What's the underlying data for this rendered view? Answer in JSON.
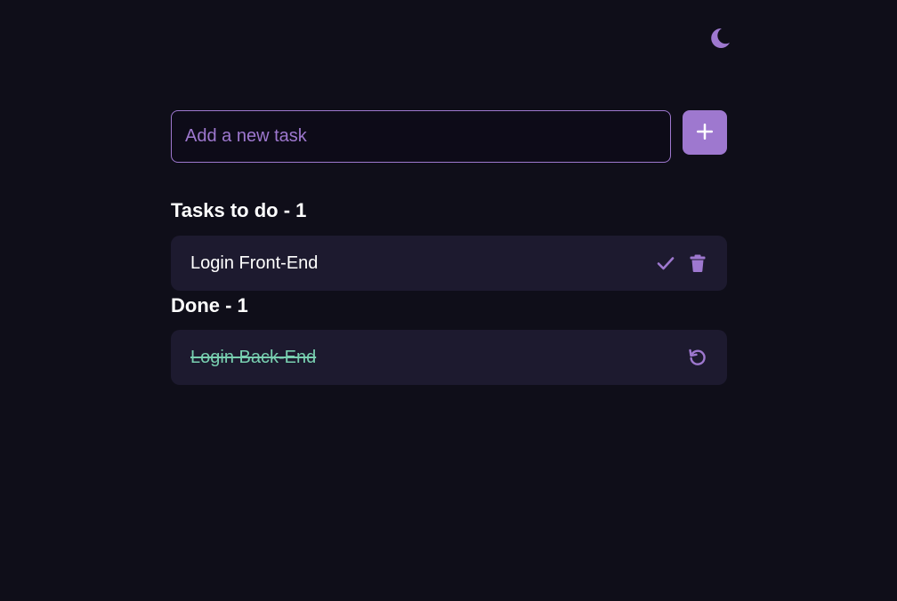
{
  "header": {
    "theme_icon": "moon-icon"
  },
  "new_task": {
    "placeholder": "Add a new task",
    "value": "",
    "add_icon": "plus-icon"
  },
  "todo": {
    "title": "Tasks to do - 1",
    "items": [
      {
        "label": "Login Front-End",
        "actions": [
          "check-icon",
          "trash-icon"
        ]
      }
    ]
  },
  "done": {
    "title": "Done - 1",
    "items": [
      {
        "label": "Login Back-End",
        "actions": [
          "undo-icon"
        ]
      }
    ]
  },
  "colors": {
    "background": "#0f0e19",
    "accent": "#9e78cf",
    "card": "#1d1a2f",
    "done_text": "#78cfb0",
    "text": "#ffffff"
  }
}
